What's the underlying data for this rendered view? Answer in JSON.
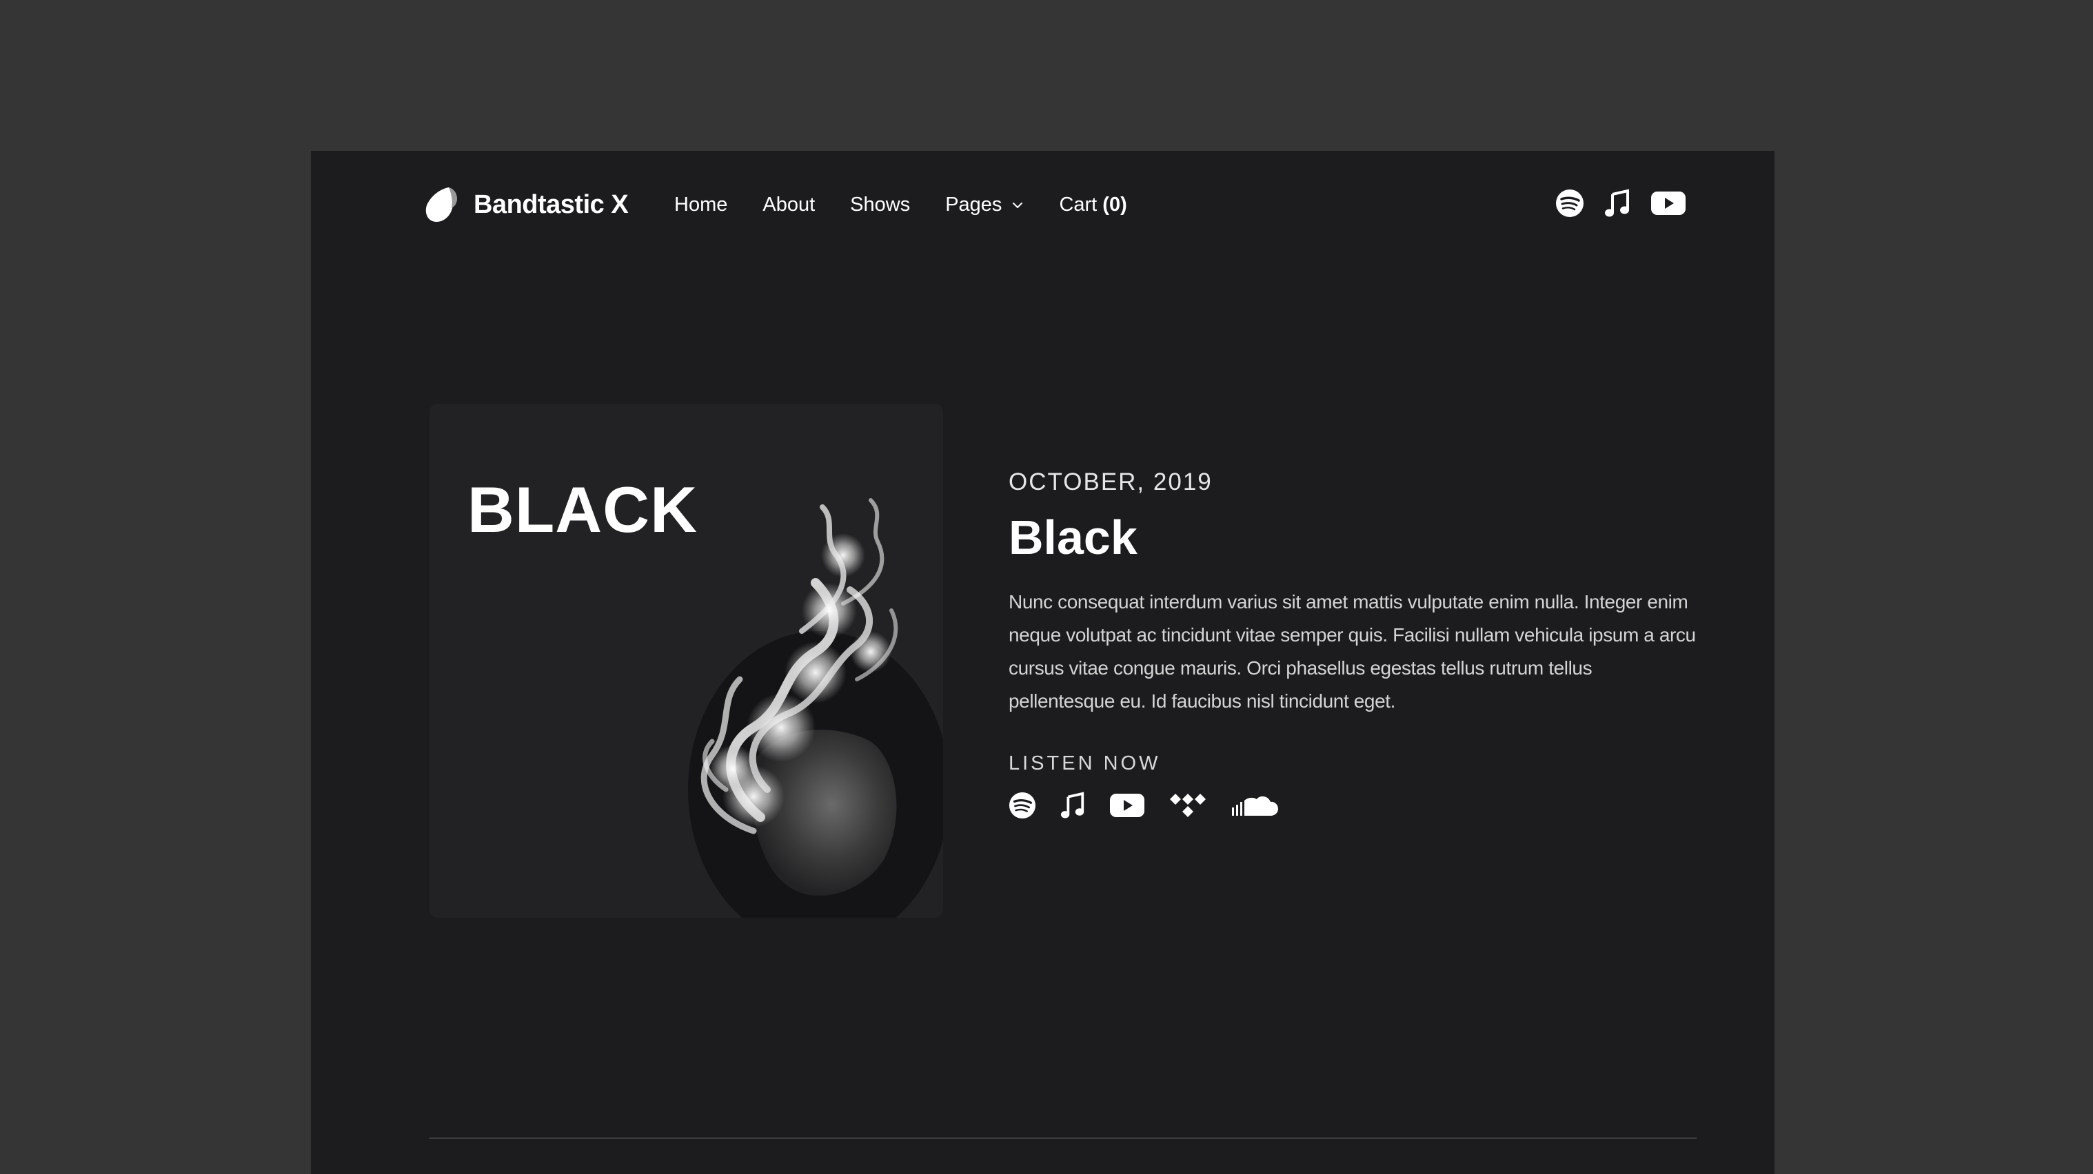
{
  "brand": {
    "name": "Bandtastic X",
    "logo_icon": "logo-leaf-icon"
  },
  "nav": {
    "items": [
      {
        "label": "Home"
      },
      {
        "label": "About"
      },
      {
        "label": "Shows"
      },
      {
        "label": "Pages",
        "has_dropdown": true
      },
      {
        "label": "Cart",
        "count": "(0)"
      }
    ]
  },
  "header_social": [
    {
      "icon": "spotify-icon"
    },
    {
      "icon": "apple-music-icon"
    },
    {
      "icon": "youtube-icon"
    }
  ],
  "album": {
    "cover_text": "BLACK",
    "release_date": "OCTOBER, 2019",
    "title": "Black",
    "description": "Nunc consequat interdum varius sit amet mattis vulputate enim nulla. Integer enim neque volutpat ac tincidunt vitae semper quis. Facilisi nullam vehicula ipsum a arcu cursus vitae congue mauris. Orci phasellus egestas tellus rutrum tellus pellentesque eu. Id faucibus nisl tincidunt eget.",
    "listen_label": "LISTEN NOW",
    "listen_icons": [
      "spotify-icon",
      "apple-music-icon",
      "youtube-icon",
      "tidal-icon",
      "soundcloud-icon"
    ]
  },
  "colors": {
    "page_bg": "#353535",
    "frame_bg": "#1c1c1f",
    "text": "#ffffff",
    "muted_text": "#d4d4d4"
  }
}
